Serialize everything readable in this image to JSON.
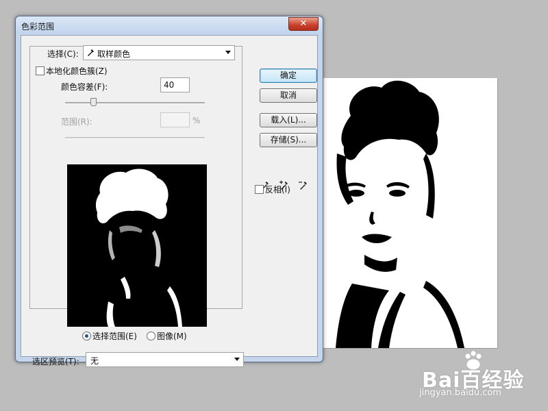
{
  "dialog": {
    "title": "色彩范围",
    "close_glyph": "✕",
    "select": {
      "label": "选择(C):",
      "value": "取样颜色"
    },
    "localized_clusters": {
      "label": "本地化颜色簇(Z)",
      "checked": false
    },
    "fuzziness": {
      "label": "颜色容差(F):",
      "value": "40",
      "slider_fraction": 0.2
    },
    "range": {
      "label": "范围(R):",
      "value": "",
      "unit": "%"
    },
    "view": {
      "selection_label": "选择范围(E)",
      "image_label": "图像(M)",
      "selected": "selection"
    },
    "selection_preview": {
      "label": "选区预览(T):",
      "value": "无"
    },
    "buttons": {
      "ok": "确定",
      "cancel": "取消",
      "load": "载入(L)...",
      "save": "存储(S)..."
    },
    "eyedroppers": [
      "eyedropper-icon",
      "eyedropper-plus-icon",
      "eyedropper-minus-icon"
    ],
    "invert": {
      "label": "反相(I)",
      "checked": false
    }
  },
  "watermark": {
    "brand": "Bai百经验",
    "url": "jingyan.baidu.com"
  }
}
